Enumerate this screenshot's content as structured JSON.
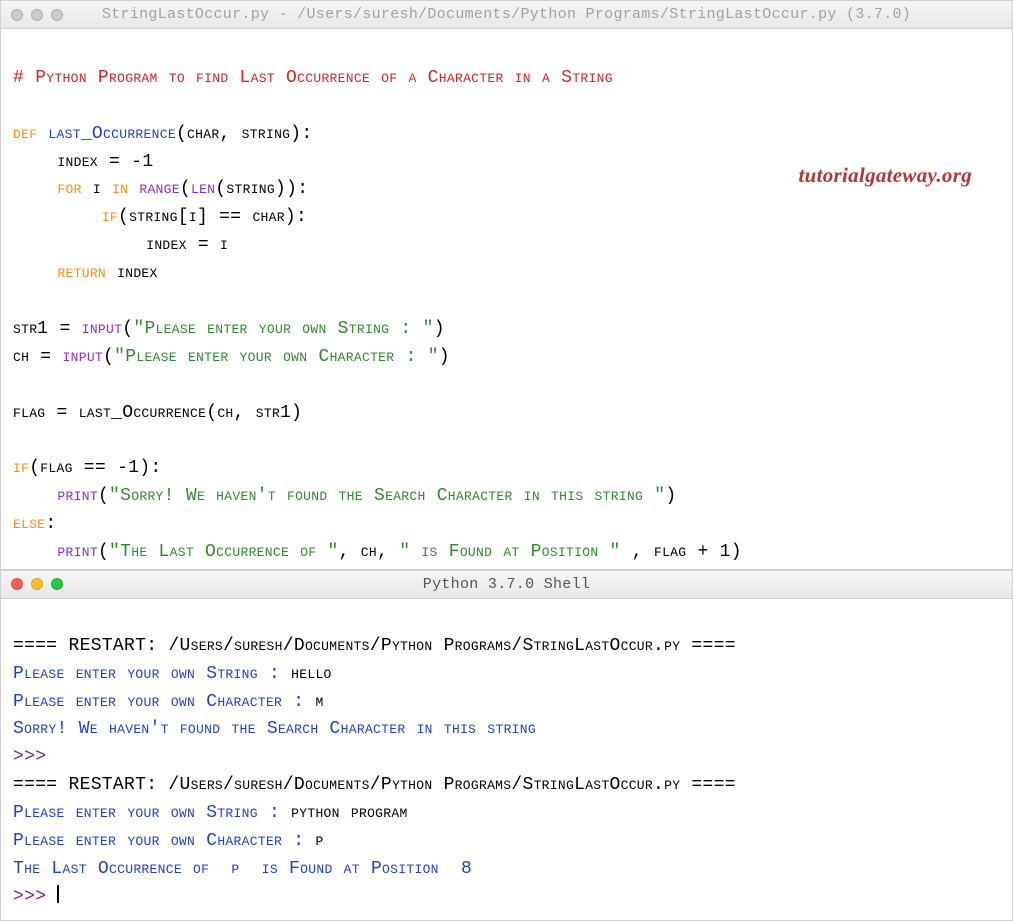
{
  "editor": {
    "title": "StringLastOccur.py - /Users/suresh/Documents/Python Programs/StringLastOccur.py (3.7.0)",
    "watermark": "tutorialgateway.org",
    "code": {
      "comment": "# Python Program to find Last Occurrence of a Character in a String",
      "def_kw": "def",
      "func_name": "last_Occurrence",
      "params": "(char, string):",
      "l1": "    index = -1",
      "for_kw": "for",
      "in_kw": "in",
      "loop_var": " i ",
      "range_call": "range",
      "len_call": "len",
      "range_tail": "(string)):",
      "if_kw": "if",
      "if_tail": "(string[i] == char):",
      "l_assign": "            index = i",
      "return_kw": "return",
      "return_tail": " index",
      "str1_lhs": "str1 = ",
      "input_call": "input",
      "str1_arg": "\"Please enter your own String : \"",
      "ch_lhs": "ch = ",
      "ch_arg": "\"Please enter your own Character : \"",
      "flag_line": "flag = last_Occurrence(ch, str1)",
      "if2_kw": "if",
      "if2_tail": "(flag == -1):",
      "print_call": "print",
      "print1_arg": "\"Sorry! We haven't found the Search Character in this string \"",
      "else_kw": "else",
      "print2_a": "\"The Last Occurrence of \"",
      "print2_b": ", ch, ",
      "print2_c": "\" is Found at Position \"",
      "print2_d": " , flag + 1)"
    }
  },
  "shell": {
    "title": "Python 3.7.0 Shell",
    "restart1": "==== RESTART: /Users/suresh/Documents/Python Programs/StringLastOccur.py ====",
    "p1a": "Please enter your own String : ",
    "p1a_in": "hello",
    "p1b": "Please enter your own Character : ",
    "p1b_in": "m",
    "out1": "Sorry! We haven't found the Search Character in this string ",
    "prompt": ">>> ",
    "restart2": "==== RESTART: /Users/suresh/Documents/Python Programs/StringLastOccur.py ====",
    "p2a": "Please enter your own String : ",
    "p2a_in": "python program",
    "p2b": "Please enter your own Character : ",
    "p2b_in": "p",
    "out2": "The Last Occurrence of  p  is Found at Position  8"
  }
}
